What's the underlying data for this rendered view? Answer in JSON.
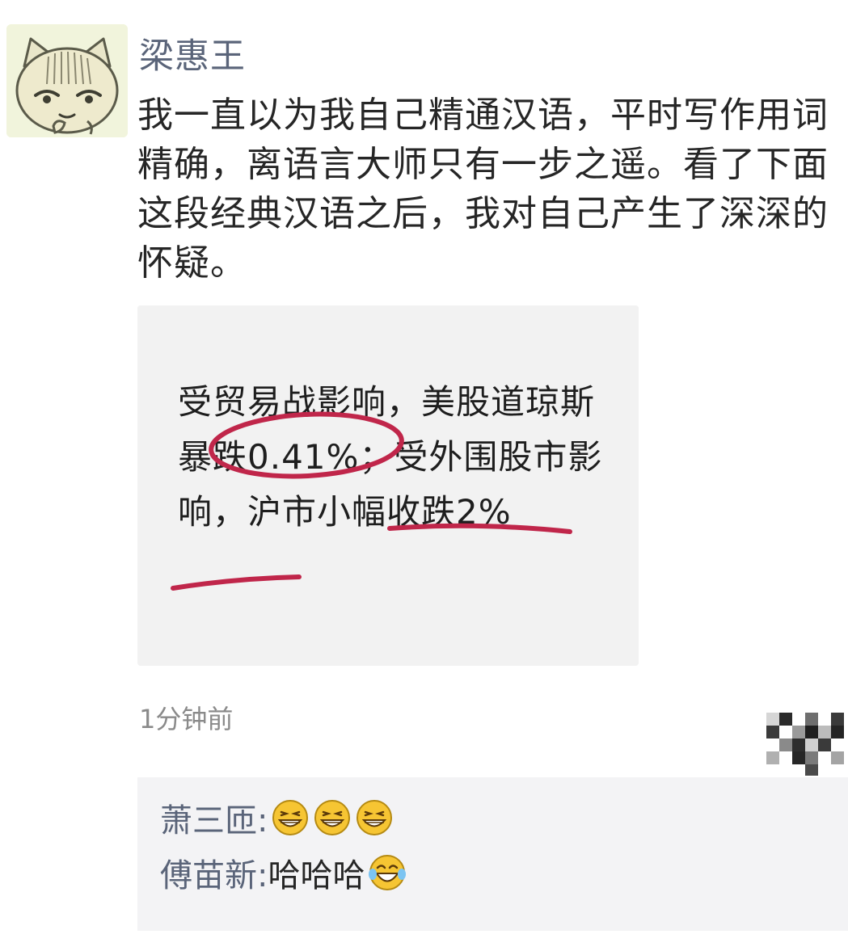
{
  "post": {
    "author": "梁惠王",
    "text": "我一直以为我自己精通汉语，平时写作用词精确，离语言大师只有一步之遥。看了下面这段经典汉语之后，我对自己产生了深深的怀疑。",
    "avatar_icon": "cartoon-cat-avatar",
    "image": {
      "text": "受贸易战影响，美股道琼斯暴跌0.41%；受外围股市影响，沪市小幅收跌2%",
      "marks_color": "#c0264a"
    },
    "time": "1分钟前",
    "more_icon": "pixelated-more-icon"
  },
  "comments": [
    {
      "name": "萧三匝:",
      "text": "",
      "emojis": [
        "grin-emoji",
        "grin-emoji",
        "grin-emoji"
      ]
    },
    {
      "name": "傅苗新:",
      "text": "哈哈哈",
      "emojis": [
        "laugh-tears-emoji"
      ]
    }
  ],
  "colors": {
    "author_name": "#5a6479",
    "body_text": "#262626",
    "time_text": "#8a8a8a",
    "comment_bg": "#f3f3f5",
    "emoji_yellow": "#f6c533"
  }
}
